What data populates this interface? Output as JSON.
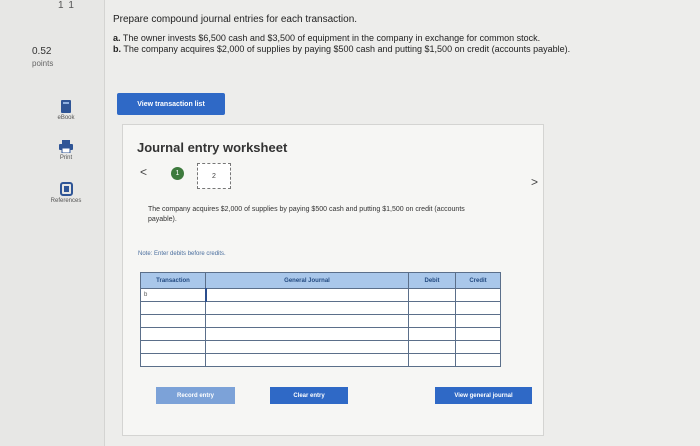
{
  "sidebar": {
    "mark": "1 1",
    "score_value": "0.52",
    "score_label": "points",
    "tools": [
      {
        "label": "eBook",
        "icon": "book-icon"
      },
      {
        "label": "Print",
        "icon": "printer-icon"
      },
      {
        "label": "References",
        "icon": "references-icon"
      }
    ]
  },
  "question": {
    "prompt": "Prepare compound journal entries for each transaction.",
    "items": [
      {
        "letter": "a.",
        "text": "The owner invests $6,500 cash and $3,500 of equipment in the company in exchange for common stock."
      },
      {
        "letter": "b.",
        "text": "The company acquires $2,000 of supplies by paying $500 cash and putting $1,500 on credit (accounts payable)."
      }
    ],
    "view_button": "View transaction list"
  },
  "worksheet": {
    "title": "Journal entry worksheet",
    "prev": "<",
    "next": ">",
    "step1": "1",
    "step2": "2",
    "description": "The company acquires $2,000 of supplies by paying $500 cash and putting $1,500 on credit (accounts payable).",
    "note": "Note: Enter debits before credits.",
    "table": {
      "headers": [
        "Transaction",
        "General Journal",
        "Debit",
        "Credit"
      ],
      "rows": [
        [
          "b",
          "",
          "",
          ""
        ],
        [
          "",
          "",
          "",
          ""
        ],
        [
          "",
          "",
          "",
          ""
        ],
        [
          "",
          "",
          "",
          ""
        ],
        [
          "",
          "",
          "",
          ""
        ],
        [
          "",
          "",
          "",
          ""
        ]
      ]
    },
    "record_button": "Record entry",
    "clear_button": "Clear entry",
    "general_journal_button": "View general journal"
  },
  "colors": {
    "primary_blue": "#2f69c6",
    "header_blue": "#a9c7ea",
    "step_green": "#3d7a3d",
    "disabled_blue": "#7ca2d8"
  }
}
